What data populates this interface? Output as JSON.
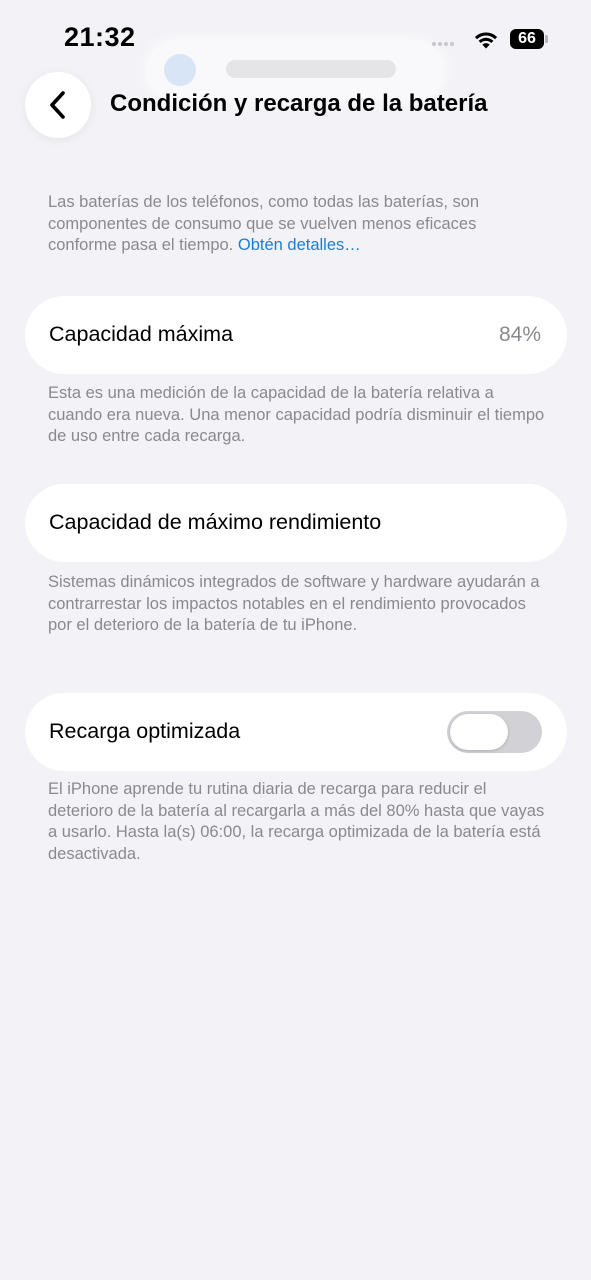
{
  "status": {
    "time": "21:32",
    "battery": "66"
  },
  "header": {
    "title": "Condición y recarga de la batería"
  },
  "intro": {
    "text": "Las baterías de los teléfonos, como todas las baterías, son componentes de consumo que se vuelven menos eficaces conforme pasa el tiempo.",
    "link": "Obtén detalles…"
  },
  "max_capacity": {
    "label": "Capacidad máxima",
    "value": "84%",
    "description": "Esta es una medición de la capacidad de la batería relativa a cuando era nueva. Una menor capacidad podría disminuir el tiempo de uso entre cada recarga."
  },
  "peak_performance": {
    "label": "Capacidad de máximo rendimiento",
    "description": "Sistemas dinámicos integrados de software y hardware ayudarán a contrarrestar los impactos notables en el rendimiento provocados por el deterioro de la batería de tu iPhone."
  },
  "optimized_charging": {
    "label": "Recarga optimizada",
    "enabled": false,
    "description": "El iPhone aprende tu rutina diaria de recarga para reducir el deterioro de la batería al recargarla a más del 80% hasta que vayas a usarlo. Hasta la(s) 06:00, la recarga optimizada de la batería está desactivada."
  },
  "colors": {
    "background": "#f2f2f7",
    "link": "#1a7fd4",
    "secondary_text": "#8a8a8e",
    "toggle_off": "#d1d1d6"
  },
  "icons": {
    "back": "chevron-left-icon",
    "wifi": "wifi-icon",
    "battery": "battery-icon"
  }
}
